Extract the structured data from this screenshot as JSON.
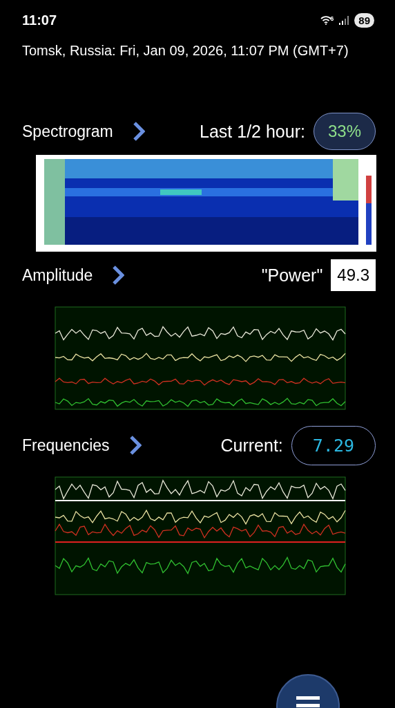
{
  "status_bar": {
    "time": "11:07",
    "wifi_badge": "6",
    "battery": "89"
  },
  "location": "Tomsk, Russia: Fri, Jan 09, 2026, 11:07 PM (GMT+7)",
  "sections": [
    {
      "title": "Spectrogram",
      "label": "Last 1/2 hour:",
      "value": "33%",
      "kind": "pill",
      "chart": {
        "kind": "spectrogram"
      }
    },
    {
      "title": "Amplitude",
      "label": "\"Power\"",
      "value": "49.3",
      "kind": "box",
      "chart": {
        "kind": "amplitude"
      }
    },
    {
      "title": "Frequencies",
      "label": "Current:",
      "value": "7.29",
      "kind": "outline",
      "chart": {
        "kind": "frequencies"
      }
    }
  ]
}
